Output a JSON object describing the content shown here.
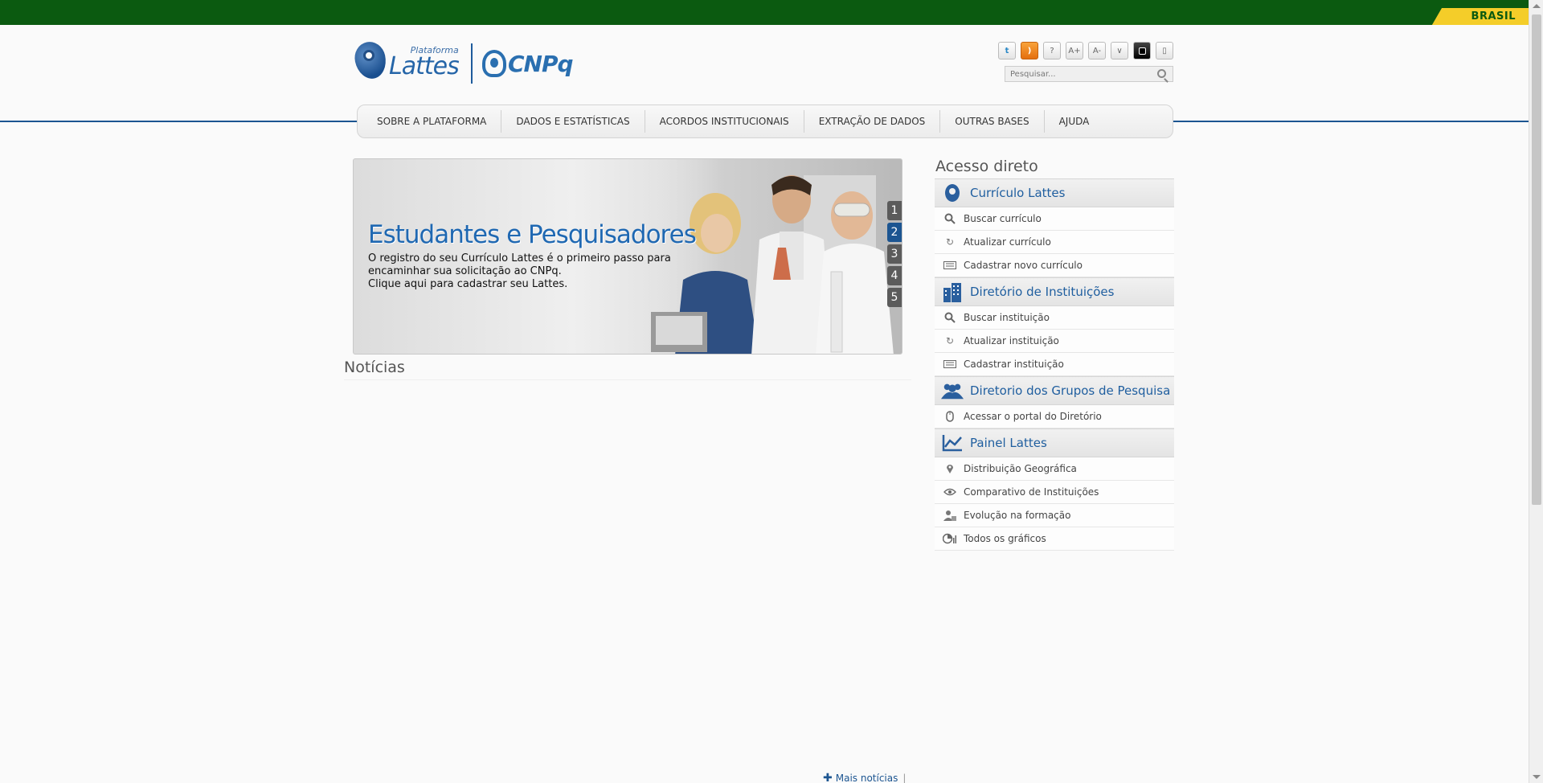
{
  "gov_bar": {
    "label": "BRASIL"
  },
  "header": {
    "lattes_small": "Plataforma",
    "lattes_big": "Lattes",
    "cnpq": "CNPq",
    "search_placeholder": "Pesquisar...",
    "tools": [
      {
        "icon": "twitter-icon",
        "glyph": "t"
      },
      {
        "icon": "rss-icon",
        "glyph": ")"
      },
      {
        "icon": "help-icon",
        "glyph": "?"
      },
      {
        "icon": "font-increase-icon",
        "glyph": "A+"
      },
      {
        "icon": "font-decrease-icon",
        "glyph": "A-"
      },
      {
        "icon": "chevron-down-icon",
        "glyph": "∨"
      },
      {
        "icon": "contrast-icon",
        "glyph": ""
      },
      {
        "icon": "lock-icon",
        "glyph": "▯"
      }
    ]
  },
  "nav": {
    "items": [
      "SOBRE A PLATAFORMA",
      "DADOS E ESTATÍSTICAS",
      "ACORDOS INSTITUCIONAIS",
      "EXTRAÇÃO DE DADOS",
      "OUTRAS BASES",
      "AJUDA"
    ]
  },
  "banner": {
    "title": "Estudantes e Pesquisadores",
    "line1": "O registro do seu Currículo Lattes é o primeiro passo para",
    "line2": "encaminhar sua solicitação ao CNPq.",
    "line3": "Clique aqui para cadastrar seu Lattes.",
    "pages": [
      "1",
      "2",
      "3",
      "4",
      "5"
    ],
    "active_page": "2"
  },
  "news": {
    "title": "Notícias",
    "more": "Mais notícias"
  },
  "sidebar": {
    "title": "Acesso direto",
    "sections": [
      {
        "title": "Currículo Lattes",
        "icon": "lattes-logo-icon",
        "links": [
          {
            "label": "Buscar currículo",
            "icon": "search-icon"
          },
          {
            "label": "Atualizar currículo",
            "icon": "refresh-icon"
          },
          {
            "label": "Cadastrar novo currículo",
            "icon": "keyboard-icon"
          }
        ]
      },
      {
        "title": "Diretório de Instituições",
        "icon": "building-icon",
        "links": [
          {
            "label": "Buscar instituição",
            "icon": "search-icon"
          },
          {
            "label": "Atualizar instituição",
            "icon": "refresh-icon"
          },
          {
            "label": "Cadastrar instituição",
            "icon": "keyboard-icon"
          }
        ]
      },
      {
        "title": "Diretorio dos Grupos de Pesquisa",
        "icon": "people-icon",
        "links": [
          {
            "label": "Acessar o portal do Diretório",
            "icon": "mouse-icon"
          }
        ]
      },
      {
        "title": "Painel Lattes",
        "icon": "line-chart-icon",
        "links": [
          {
            "label": "Distribuição Geográfica",
            "icon": "map-pin-icon"
          },
          {
            "label": "Comparativo de Instituições",
            "icon": "eye-icon"
          },
          {
            "label": "Evolução na formação",
            "icon": "graduate-icon"
          },
          {
            "label": "Todos os gráficos",
            "icon": "charts-icon"
          }
        ]
      }
    ]
  }
}
